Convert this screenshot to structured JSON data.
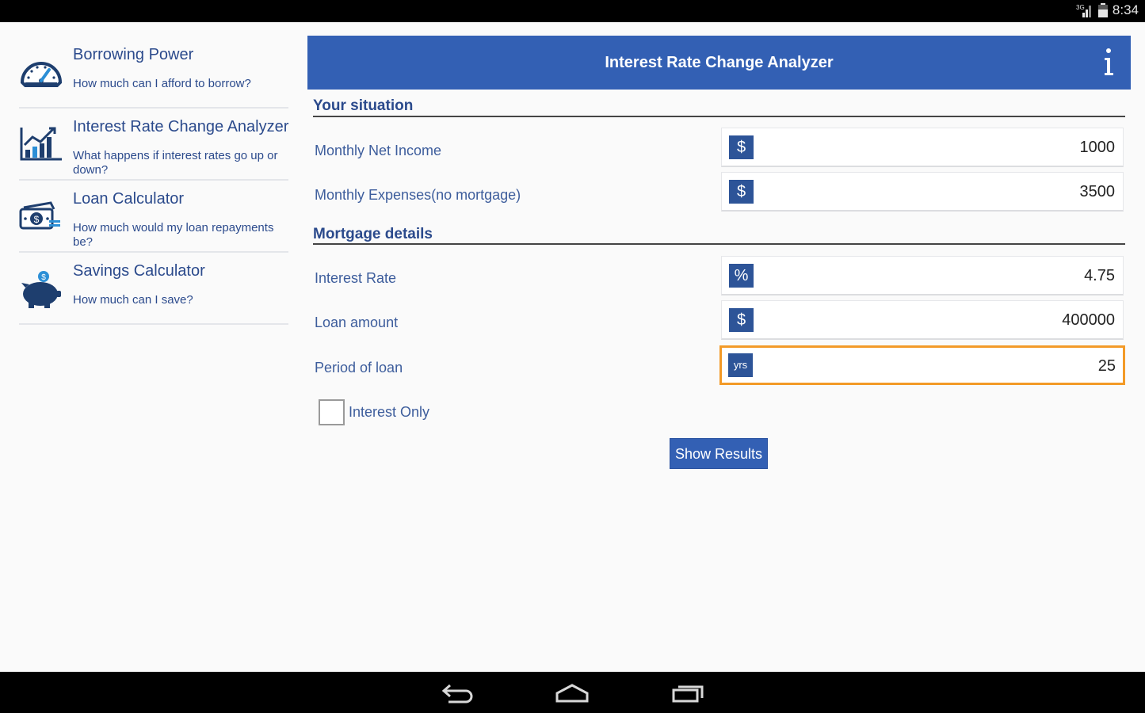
{
  "status_bar": {
    "network_label": "3G",
    "time": "8:34",
    "icons": [
      "signal-icon",
      "battery-icon"
    ]
  },
  "sidebar": {
    "items": [
      {
        "icon": "speedometer-icon",
        "title": "Borrowing Power",
        "subtitle": "How much can I afford to borrow?"
      },
      {
        "icon": "bar-chart-icon",
        "title": "Interest Rate Change Analyzer",
        "subtitle": "What happens if interest rates go up or down?"
      },
      {
        "icon": "money-icon",
        "title": "Loan Calculator",
        "subtitle": "How much would my loan repayments be?"
      },
      {
        "icon": "piggy-bank-icon",
        "title": "Savings Calculator",
        "subtitle": "How much can I save?"
      }
    ]
  },
  "header": {
    "title": "Interest Rate Change Analyzer",
    "info_icon": "info-icon"
  },
  "sections": {
    "situation_title": "Your situation",
    "mortgage_title": "Mortgage details"
  },
  "fields": {
    "monthly_net_income": {
      "label": "Monthly Net Income",
      "unit": "$",
      "value": "1000"
    },
    "monthly_expenses": {
      "label": "Monthly Expenses(no mortgage)",
      "unit": "$",
      "value": "3500"
    },
    "interest_rate": {
      "label": "Interest Rate",
      "unit": "%",
      "value": "4.75"
    },
    "loan_amount": {
      "label": "Loan amount",
      "unit": "$",
      "value": "400000"
    },
    "period_of_loan": {
      "label": "Period of loan",
      "unit": "yrs",
      "value": "25"
    }
  },
  "interest_only": {
    "label": "Interest Only",
    "checked": false
  },
  "show_results_label": "Show Results",
  "colors": {
    "header_blue": "#3360b4",
    "text_blue": "#2b4a8c",
    "icon_navy": "#2d5498",
    "focus_orange": "#f39a27"
  },
  "nav": [
    "back-icon",
    "home-icon",
    "recent-apps-icon"
  ]
}
